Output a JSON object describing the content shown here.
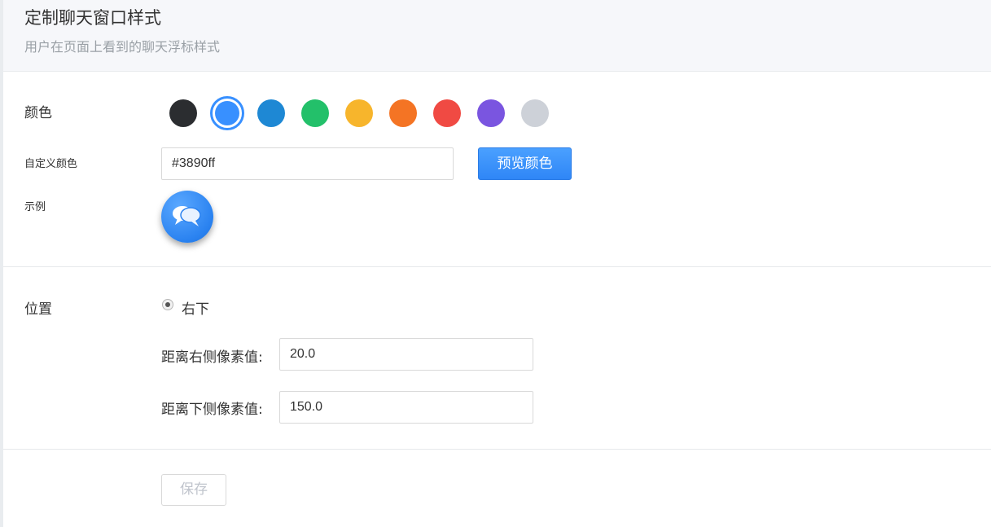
{
  "header": {
    "title": "定制聊天窗口样式",
    "subtitle": "用户在页面上看到的聊天浮标样式"
  },
  "color_section": {
    "label": "颜色",
    "swatches": [
      {
        "name": "black",
        "color": "#2b2d30",
        "selected": false
      },
      {
        "name": "blue",
        "color": "#3890ff",
        "selected": true
      },
      {
        "name": "dark-blue",
        "color": "#1e88d4",
        "selected": false
      },
      {
        "name": "green",
        "color": "#23c06a",
        "selected": false
      },
      {
        "name": "yellow",
        "color": "#f7b52c",
        "selected": false
      },
      {
        "name": "orange",
        "color": "#f47424",
        "selected": false
      },
      {
        "name": "red",
        "color": "#f04a43",
        "selected": false
      },
      {
        "name": "purple",
        "color": "#7a55e0",
        "selected": false
      },
      {
        "name": "gray",
        "color": "#cdd1d8",
        "selected": false
      }
    ],
    "custom_label": "自定义颜色",
    "custom_value": "#3890ff",
    "preview_button": "预览颜色",
    "example_label": "示例",
    "example_icon": "chat-bubbles-icon"
  },
  "position_section": {
    "label": "位置",
    "option_label": "右下",
    "right_label": "距离右侧像素值:",
    "right_value": "20.0",
    "bottom_label": "距离下侧像素值:",
    "bottom_value": "150.0"
  },
  "save_button": "保存",
  "colors": {
    "accent": "#3890ff",
    "disabled_text": "#c0c4cc"
  }
}
